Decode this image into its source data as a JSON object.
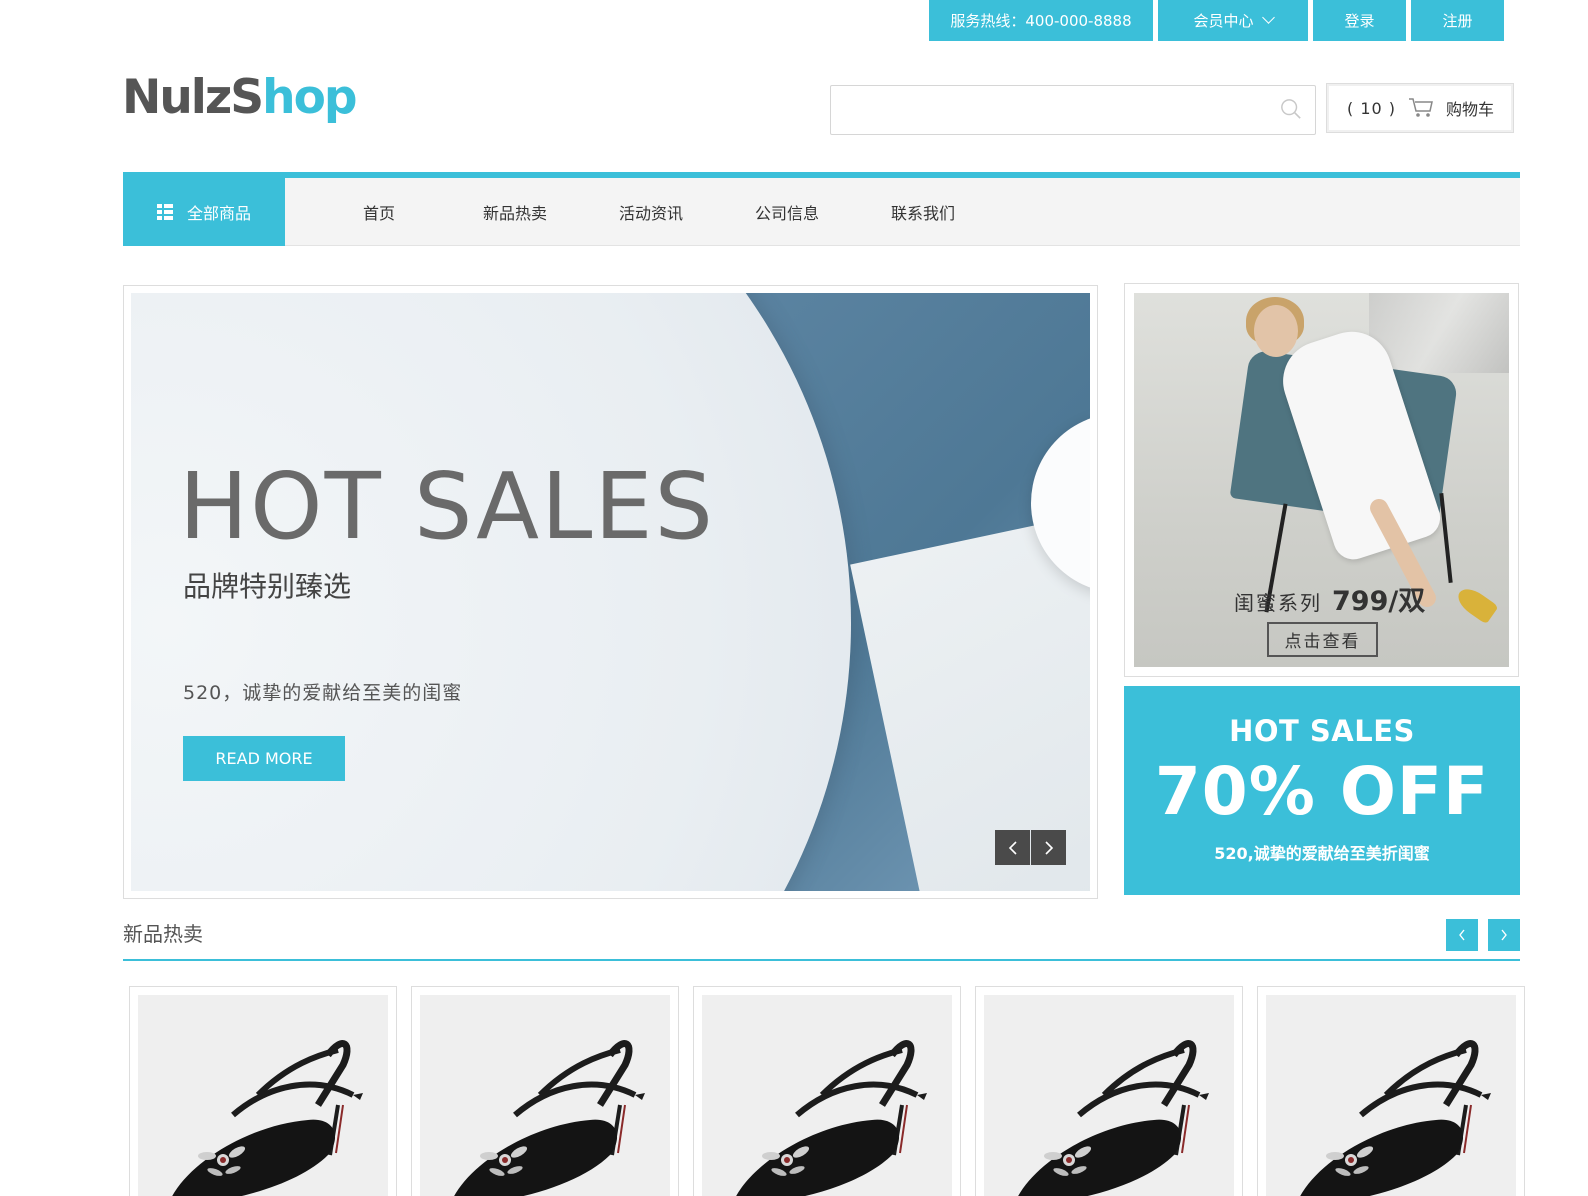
{
  "topbar": {
    "hotline": "服务热线：400-000-8888",
    "member": "会员中心",
    "login": "登录",
    "register": "注册"
  },
  "logo": {
    "part1": "NulzS",
    "part2": "hop"
  },
  "search": {
    "placeholder": "",
    "value": ""
  },
  "cart": {
    "count": "( 10 )",
    "label": "购物车"
  },
  "nav": {
    "all_categories": "全部商品",
    "items": [
      "首页",
      "新品热卖",
      "活动资讯",
      "公司信息",
      "联系我们"
    ]
  },
  "banner": {
    "headline": "HOT SALES",
    "subtitle": "品牌特别臻选",
    "description": "520，诚挚的爱献给至美的闺蜜",
    "cta": "READ MORE"
  },
  "side_ad": {
    "name": "闺蜜系列",
    "price": "799/双",
    "button": "点击查看"
  },
  "promo": {
    "line1": "HOT SALES",
    "line2": "70% OFF",
    "line3": "520,诚挚的爱献给至美折闺蜜"
  },
  "section": {
    "title": "新品热卖"
  },
  "products": [
    {
      "image": "black-heel-sandal"
    },
    {
      "image": "black-heel-sandal"
    },
    {
      "image": "black-heel-sandal"
    },
    {
      "image": "black-heel-sandal"
    },
    {
      "image": "black-heel-sandal"
    }
  ],
  "colors": {
    "accent": "#3bbfd9",
    "nav_bg": "#f4f4f4",
    "text": "#333333"
  }
}
